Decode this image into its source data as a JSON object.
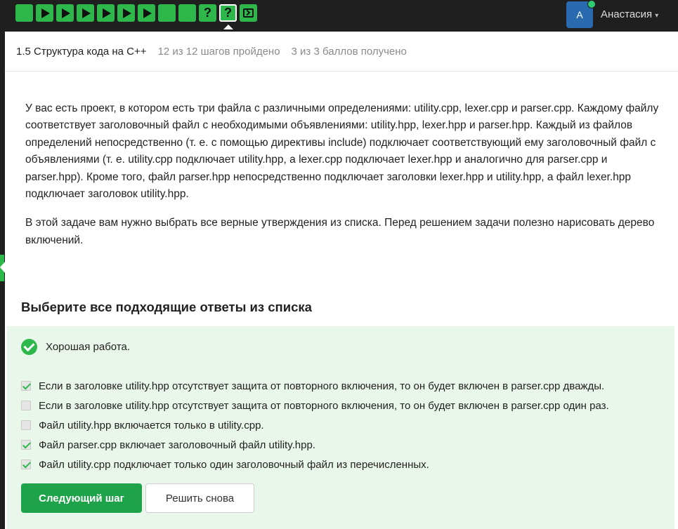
{
  "topbar": {
    "steps": [
      {
        "type": "check"
      },
      {
        "type": "play"
      },
      {
        "type": "play"
      },
      {
        "type": "play"
      },
      {
        "type": "play"
      },
      {
        "type": "play"
      },
      {
        "type": "play"
      },
      {
        "type": "check"
      },
      {
        "type": "check"
      },
      {
        "type": "question",
        "label": "?"
      },
      {
        "type": "question",
        "label": "?",
        "current": true
      },
      {
        "type": "code"
      }
    ],
    "avatar_letter": "А",
    "user_name": "Анастасия"
  },
  "header": {
    "lesson_title": "1.5 Структура кода на C++",
    "steps_progress": "12 из 12 шагов пройдено",
    "points_progress": "3 из 3 баллов  получено"
  },
  "task": {
    "paragraph1": "У вас есть проект, в котором есть три файла с различными определениями: utility.cpp, lexer.cpp и parser.cpp. Каждому файлу соответствует заголовочный файл с необходимыми объявлениями: utility.hpp, lexer.hpp и parser.hpp. Каждый из файлов определений непосредственно (т. е. с помощью директивы include) подключает соответствующий ему заголовочный файл с объявлениями (т. е. utility.cpp подключает utility.hpp, а lexer.cpp подключает lexer.hpp и аналогично для parser.cpp и parser.hpp). Кроме того, файл parser.hpp непосредственно подключает заголовки lexer.hpp и utility.hpp, а файл lexer.hpp подключает заголовок utility.hpp.",
    "paragraph2": "В этой задаче вам нужно выбрать все верные утверждения из списка. Перед решением задачи полезно нарисовать дерево включений."
  },
  "quiz": {
    "title": "Выберите все подходящие ответы из списка",
    "feedback": "Хорошая работа.",
    "options": [
      {
        "text": "Если в заголовке utility.hpp отсутствует защита от повторного включения, то он будет включен в parser.cpp дважды.",
        "checked": true
      },
      {
        "text": "Если в заголовке utility.hpp отсутствует защита от повторного включения, то он будет включен в parser.cpp один раз.",
        "checked": false
      },
      {
        "text": "Файл utility.hpp включается только в utility.cpp.",
        "checked": false
      },
      {
        "text": "Файл parser.cpp включает заголовочный файл utility.hpp.",
        "checked": true
      },
      {
        "text": "Файл utility.cpp подключает только один заголовочный файл из перечисленных.",
        "checked": true
      }
    ],
    "next_button": "Следующий шаг",
    "retry_button": "Решить снова"
  },
  "colors": {
    "accent": "#2eb84b",
    "success_bg": "#e9f6ea",
    "topbar": "#1f1f1f",
    "avatar": "#2a6bb0"
  }
}
